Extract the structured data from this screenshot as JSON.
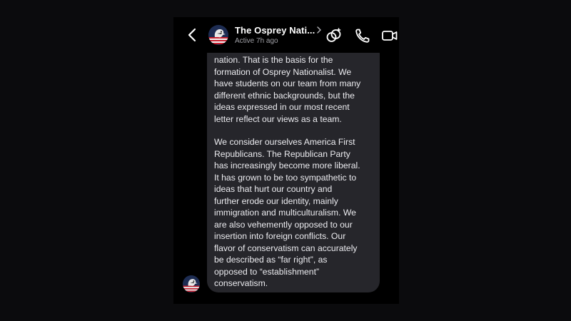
{
  "header": {
    "back_icon": "chevron-left-icon",
    "contact_name": "The Osprey Nati...",
    "status": "Active 7h ago",
    "actions": [
      "games-icon",
      "phone-icon",
      "video-camera-icon"
    ]
  },
  "message": {
    "paragraphs": [
      "nation. That is the basis for the\nformation of Osprey Nationalist. We\nhave students on our team from many\ndifferent ethnic backgrounds, but the\nideas expressed in our most recent\nletter reflect our views as a team.",
      "We consider ourselves America First\nRepublicans. The Republican Party\nhas increasingly become more liberal.\nIt has grown to be too sympathetic to\nideas that hurt our country and\nfurther erode our identity, mainly\nimmigration and multiculturalism. We\nare also vehemently opposed to our\ninsertion into foreign conflicts. Our\nflavor of conservatism can accurately\nbe described as “far right”, as\nopposed to “establishment”\nconservatism."
    ]
  },
  "colors": {
    "background": "#000000",
    "bubble": "#26262b",
    "text": "#ececf0",
    "muted": "#a0a0a6"
  }
}
